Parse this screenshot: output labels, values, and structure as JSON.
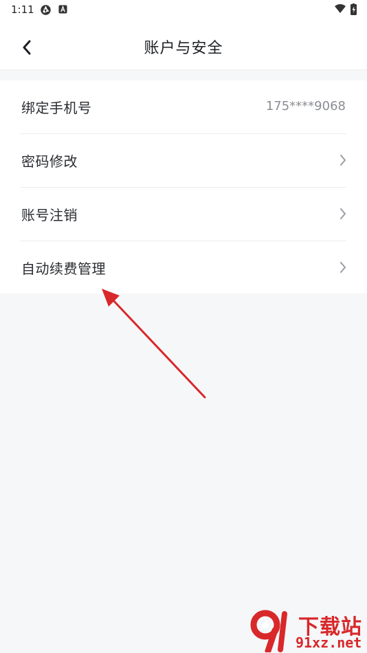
{
  "status_bar": {
    "time": "1:11"
  },
  "header": {
    "title": "账户与安全",
    "back_icon": "chevron-left-icon"
  },
  "settings": {
    "items": [
      {
        "label": "绑定手机号",
        "value": "175****9068"
      },
      {
        "label": "密码修改",
        "icon": "chevron-right-icon"
      },
      {
        "label": "账号注销",
        "icon": "chevron-right-icon"
      },
      {
        "label": "自动续费管理",
        "icon": "chevron-right-icon"
      }
    ]
  },
  "watermark": {
    "title": "下载站",
    "url": "91xz.net"
  },
  "colors": {
    "background": "#f6f7f9",
    "surface": "#ffffff",
    "text_primary": "#2a2c31",
    "text_secondary": "#8a8d93",
    "annotation_arrow": "#d8282a"
  }
}
